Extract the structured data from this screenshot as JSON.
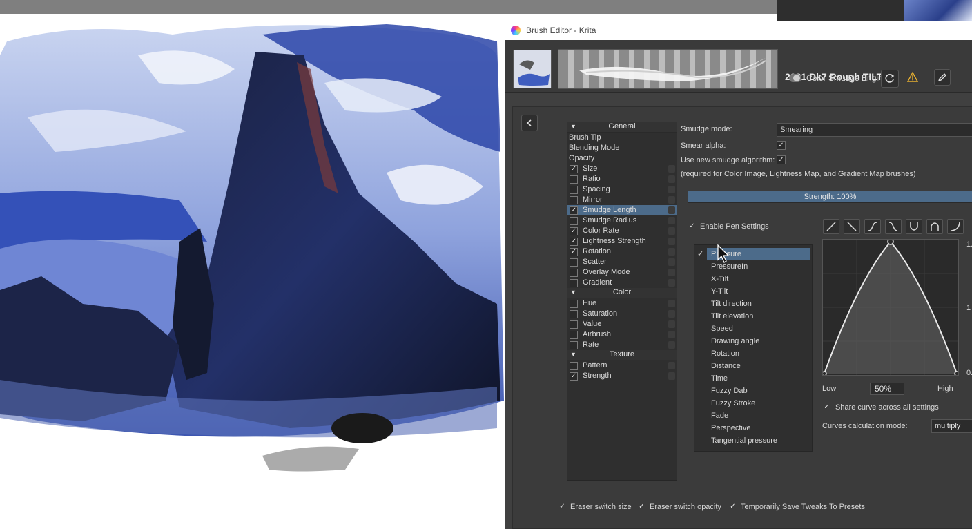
{
  "window": {
    "title": "Brush Editor - Krita"
  },
  "preset": {
    "name": "2021 Dk7 Rough TILT 01",
    "engine": "Color Smudge Engine"
  },
  "options": [
    {
      "type": "section",
      "label": "General"
    },
    {
      "type": "item",
      "label": "Brush Tip"
    },
    {
      "type": "item",
      "label": "Blending Mode"
    },
    {
      "type": "item",
      "label": "Opacity"
    },
    {
      "type": "check",
      "label": "Size",
      "checked": true
    },
    {
      "type": "check",
      "label": "Ratio",
      "checked": false
    },
    {
      "type": "check",
      "label": "Spacing",
      "checked": false
    },
    {
      "type": "check",
      "label": "Mirror",
      "checked": false
    },
    {
      "type": "check",
      "label": "Smudge Length",
      "checked": true,
      "selected": true
    },
    {
      "type": "check",
      "label": "Smudge Radius",
      "checked": false
    },
    {
      "type": "check",
      "label": "Color Rate",
      "checked": true
    },
    {
      "type": "check",
      "label": "Lightness Strength",
      "checked": true
    },
    {
      "type": "check",
      "label": "Rotation",
      "checked": true
    },
    {
      "type": "check",
      "label": "Scatter",
      "checked": false
    },
    {
      "type": "check",
      "label": "Overlay Mode",
      "checked": false
    },
    {
      "type": "check",
      "label": "Gradient",
      "checked": false
    },
    {
      "type": "section",
      "label": "Color"
    },
    {
      "type": "check",
      "label": "Hue",
      "checked": false
    },
    {
      "type": "check",
      "label": "Saturation",
      "checked": false
    },
    {
      "type": "check",
      "label": "Value",
      "checked": false
    },
    {
      "type": "check",
      "label": "Airbrush",
      "checked": false
    },
    {
      "type": "check",
      "label": "Rate",
      "checked": false
    },
    {
      "type": "section",
      "label": "Texture"
    },
    {
      "type": "check",
      "label": "Pattern",
      "checked": false
    },
    {
      "type": "check",
      "label": "Strength",
      "checked": true
    }
  ],
  "settings": {
    "smudge_mode_label": "Smudge mode:",
    "smudge_mode_value": "Smearing",
    "smear_alpha_label": "Smear alpha:",
    "new_algo_label": "Use new smudge algorithm:",
    "note": "(required for Color Image, Lightness Map, and Gradient Map brushes)",
    "strength_label": "Strength: 100%",
    "strength_value": 100,
    "enable_pen_label": "Enable Pen Settings"
  },
  "sensors": [
    "Pressure",
    "PressureIn",
    "X-Tilt",
    "Y-Tilt",
    "Tilt direction",
    "Tilt elevation",
    "Speed",
    "Drawing angle",
    "Rotation",
    "Distance",
    "Time",
    "Fuzzy Dab",
    "Fuzzy Stroke",
    "Fade",
    "Perspective",
    "Tangential pressure"
  ],
  "sensor_selected": "Pressure",
  "curve": {
    "low_label": "Low",
    "high_label": "High",
    "percent": "50%",
    "y_top_label": "1.",
    "y_mid_label": "1",
    "y_bottom_label": "0.",
    "share_label": "Share curve across all settings",
    "calc_mode_label": "Curves calculation mode:",
    "calc_mode_value": "multiply"
  },
  "footer": {
    "eraser_size": "Eraser switch size",
    "eraser_opacity": "Eraser switch opacity",
    "temp_save": "Temporarily Save Tweaks To Presets"
  },
  "colors": {
    "accent": "#4c6b8a",
    "panel": "#404040",
    "painting_blue": "#2a3f8a"
  }
}
